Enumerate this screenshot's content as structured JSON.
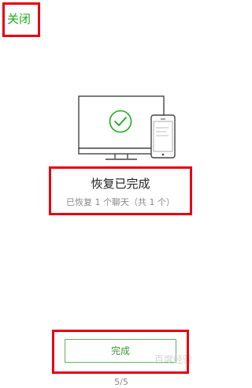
{
  "header": {
    "close_label": "关闭"
  },
  "status": {
    "title": "恢复已完成",
    "detail": "已恢复 1 个聊天（共 1 个）"
  },
  "actions": {
    "done_label": "完成"
  },
  "pager": {
    "text": "5/5"
  },
  "watermark": {
    "text": "百度经验"
  },
  "colors": {
    "accent_green": "#1aad19",
    "button_text_green": "#3a9b35",
    "button_border_green": "#5cb85c",
    "highlight_red": "#e60012",
    "muted_gray": "#888888",
    "device_stroke": "#444444"
  },
  "icons": {
    "illustration": "computer-and-phone-check-icon"
  }
}
